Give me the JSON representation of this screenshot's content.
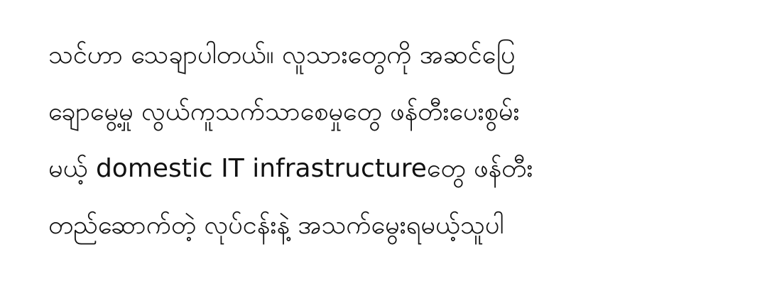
{
  "document": {
    "lines": [
      "သင်ဟာ သေချာပါတယ်။ လူသားတွေကို အဆင်ပြေ",
      "ချောမွေ့မှု လွယ်ကူသက်သာစေမှုတွေ ဖန်တီးပေးစွမ်း",
      "မယ့် domestic IT infrastructureတွေ ဖန်တီး",
      "တည်ဆောက်တဲ့ လုပ်ငန်းနဲ့ အသက်မွေးရမယ့်သူပါ"
    ]
  }
}
